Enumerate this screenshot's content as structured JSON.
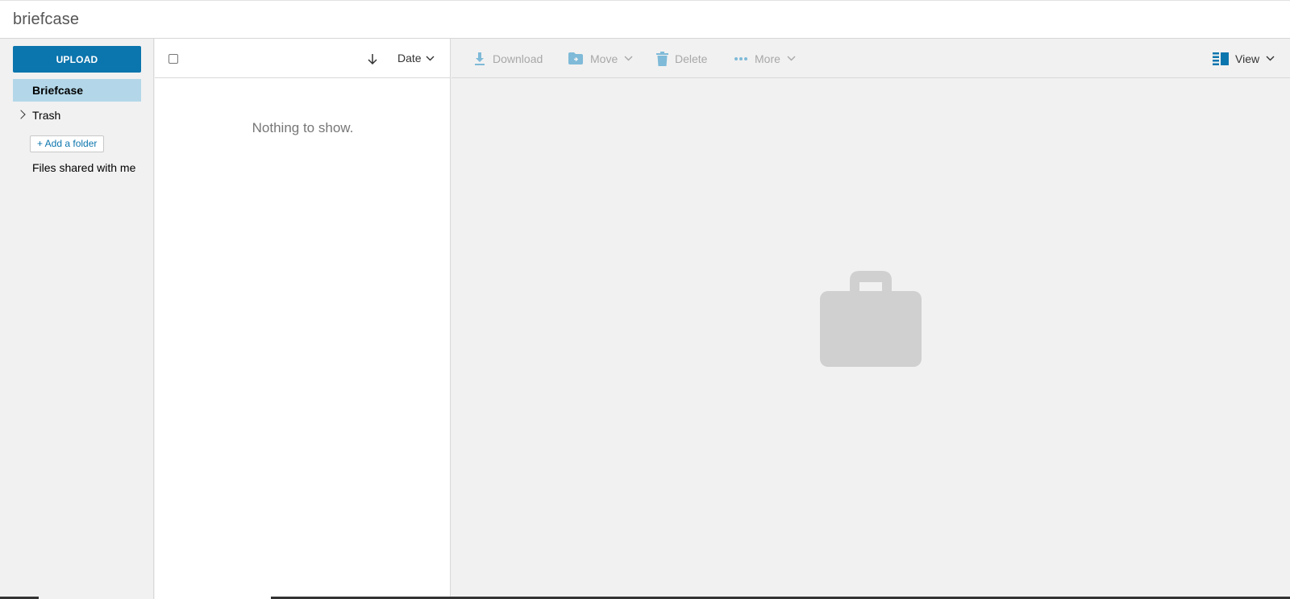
{
  "app": {
    "title": "briefcase"
  },
  "sidebar": {
    "upload_label": "UPLOAD",
    "items": [
      {
        "label": "Briefcase",
        "selected": true
      },
      {
        "label": "Trash",
        "expandable": true
      }
    ],
    "add_folder_label": "+ Add a folder",
    "shared_label": "Files shared with me"
  },
  "list": {
    "sort_field": "Date",
    "empty_message": "Nothing to show."
  },
  "toolbar": {
    "download_label": "Download",
    "move_label": "Move",
    "delete_label": "Delete",
    "more_label": "More",
    "view_label": "View"
  },
  "colors": {
    "accent": "#0b75ad",
    "selected_bg": "#b3d7e8",
    "disabled_icon": "#7fbad8",
    "placeholder_icon": "#d0d0d0"
  },
  "icons": [
    "sort-arrow-icon",
    "chevron-down-icon",
    "chevron-right-icon",
    "download-icon",
    "folder-move-icon",
    "trash-icon",
    "more-dots-icon",
    "view-layout-icon",
    "briefcase-icon"
  ]
}
